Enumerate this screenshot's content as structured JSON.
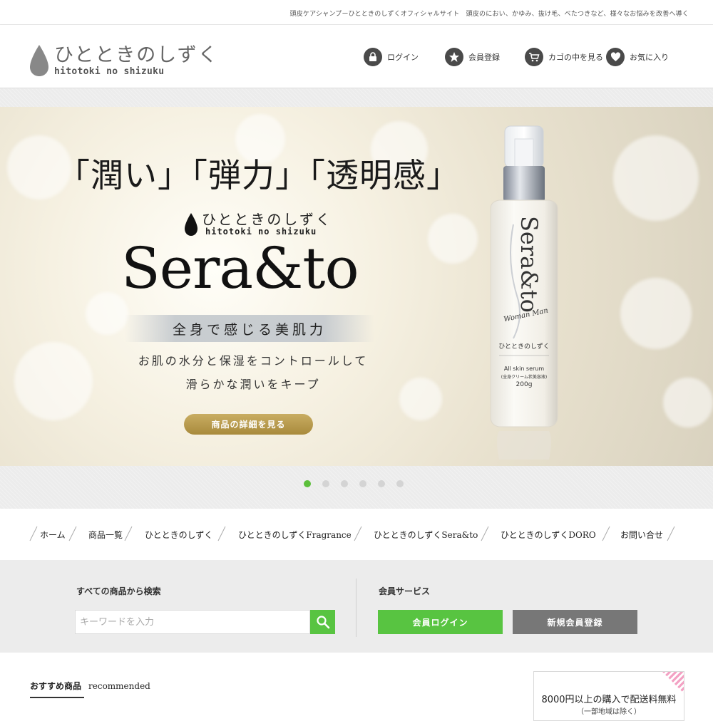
{
  "tagline": "頭皮ケアシャンプーひとときのしずくオフィシャルサイト　頭皮のにおい、かゆみ、抜け毛、べたつきなど、様々なお悩みを改善へ導く",
  "logo": {
    "jp": "ひとときのしずく",
    "en": "hitotoki no shizuku"
  },
  "header_nav": [
    {
      "label": "ログイン",
      "icon": "lock-icon"
    },
    {
      "label": "会員登録",
      "icon": "star-icon"
    },
    {
      "label": "カゴの中を見る",
      "icon": "cart-icon"
    },
    {
      "label": "お気に入り",
      "icon": "heart-icon"
    }
  ],
  "hero": {
    "headline": "「潤い」「弾力」「透明感」",
    "brand_jp": "ひとときのしずく",
    "brand_en": "hitotoki no shizuku",
    "product": "Sera&to",
    "ribbon": "全身で感じる美肌力",
    "desc_line1": "お肌の水分と保湿をコントロールして",
    "desc_line2": "滑らかな潤いをキープ",
    "button": "商品の詳細を見る",
    "bottle": {
      "vertical_logo": "Sera&to",
      "tag": "Woman Man",
      "brand": "ひとときのしずく",
      "line1": "All skin serum",
      "line2": "(全身クリーム状美容液)",
      "line3": "200g"
    }
  },
  "slider": {
    "count": 6,
    "active": 1
  },
  "global_nav": [
    "ホーム",
    "商品一覧",
    "ひとときのしずく",
    "ひとときのしずくFragrance",
    "ひとときのしずくSera&to",
    "ひとときのしずくDORO",
    "お問い合せ"
  ],
  "search": {
    "heading": "すべての商品から検索",
    "placeholder": "キーワードを入力"
  },
  "member": {
    "heading": "会員サービス",
    "login": "会員ログイン",
    "register": "新規会員登録"
  },
  "recommended": {
    "jp": "おすすめ商品",
    "en": "recommended"
  },
  "shipping": {
    "main": "8000円以上の購入で配送料無料",
    "sub": "（一部地域は除く）"
  },
  "colors": {
    "accent_green": "#58c441",
    "gold": "#b8994c",
    "gray_button": "#777777",
    "dark_icon": "#4a4a4a"
  }
}
